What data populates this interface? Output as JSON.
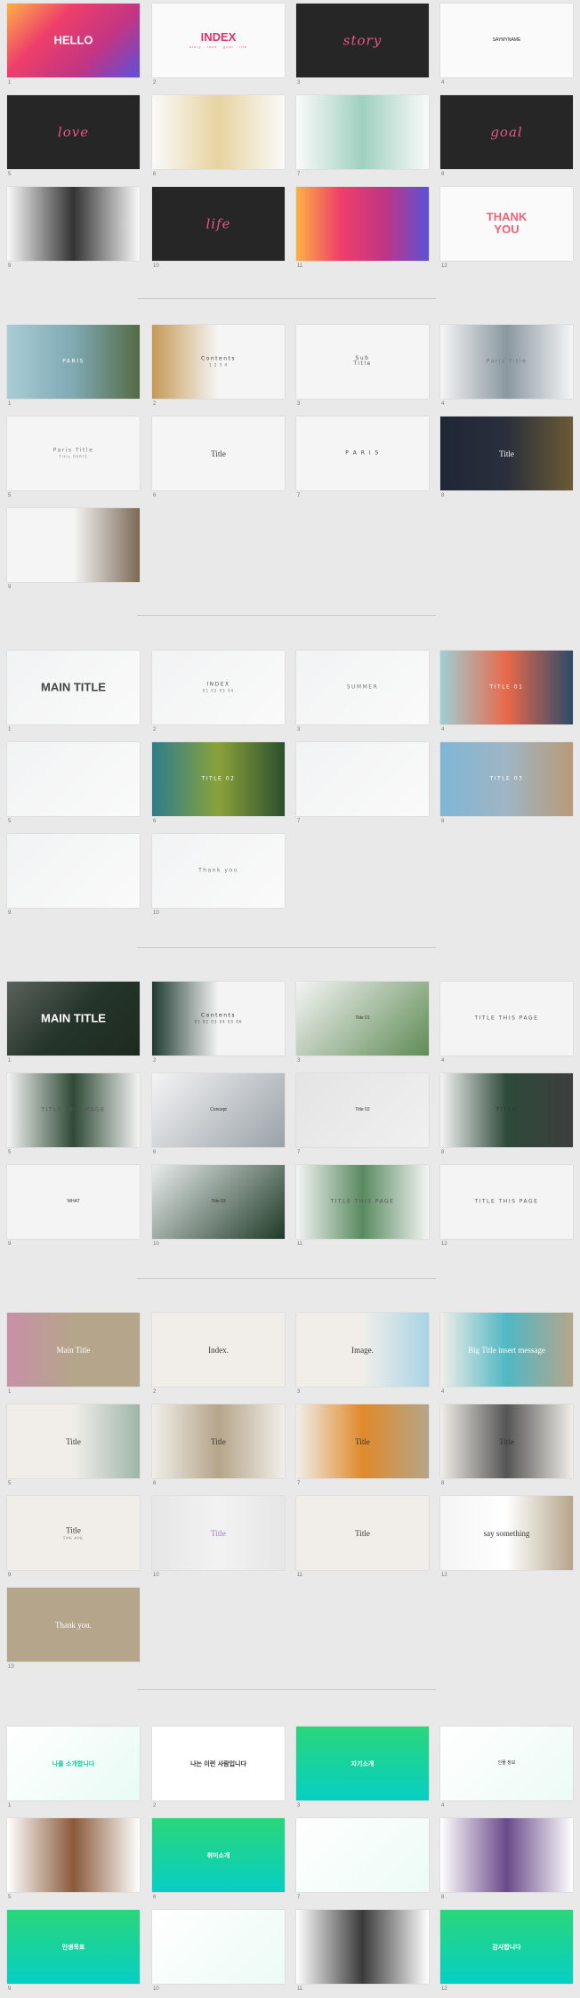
{
  "groups": [
    {
      "slides": [
        {
          "n": "1",
          "text": "HELLO",
          "style": "bold",
          "color": "#ffffff",
          "bg": [
            "#fcb045",
            "#ee3f6a",
            "#c13584",
            "#5b51d8"
          ]
        },
        {
          "n": "2",
          "text": "INDEX",
          "sub": "story · love · goal · life",
          "style": "bold",
          "color": "#e1306c",
          "bg": [
            "#fafafa",
            "#fafafa"
          ]
        },
        {
          "n": "3",
          "text": "story",
          "style": "script",
          "color": "#e8568a",
          "bg": [
            "#262626",
            "#262626"
          ]
        },
        {
          "n": "4",
          "text": "SAYMYNAME",
          "style": "small",
          "color": "#222222",
          "bg": [
            "#fafafa",
            "#fafafa"
          ]
        },
        {
          "n": "5",
          "text": "love",
          "style": "script",
          "color": "#e8568a",
          "bg": [
            "#262626",
            "#262626"
          ]
        },
        {
          "n": "6",
          "text": "",
          "style": "small",
          "color": "#222222",
          "bg": [
            "#fafafa",
            "#e7d3a0",
            "#fafafa"
          ]
        },
        {
          "n": "7",
          "text": "",
          "style": "small",
          "color": "#222222",
          "bg": [
            "#fafafa",
            "#9fd0c0",
            "#fafafa"
          ]
        },
        {
          "n": "8",
          "text": "goal",
          "style": "script",
          "color": "#e8568a",
          "bg": [
            "#262626",
            "#262626"
          ]
        },
        {
          "n": "9",
          "text": "",
          "style": "small",
          "color": "#222222",
          "bg": [
            "#fafafa",
            "#333333",
            "#fafafa"
          ]
        },
        {
          "n": "10",
          "text": "life",
          "style": "script",
          "color": "#e8568a",
          "bg": [
            "#262626",
            "#262626"
          ]
        },
        {
          "n": "11",
          "text": "",
          "style": "small",
          "color": "#ffffff",
          "bg": [
            "#fcb045",
            "#ee3f6a",
            "#c13584",
            "#5b51d8"
          ]
        },
        {
          "n": "12",
          "text": "THANK\nYOU",
          "style": "bold",
          "color": "#f0627a",
          "bg": [
            "#fafafa",
            "#fafafa"
          ]
        }
      ]
    },
    {
      "slides": [
        {
          "n": "1",
          "text": "PARIS",
          "style": "thin",
          "color": "#ffffff",
          "bg": [
            "#a9cdd6",
            "#7fa9b3",
            "#556b45"
          ]
        },
        {
          "n": "2",
          "text": "Contents",
          "sub": "1   2   3   4",
          "style": "thin",
          "color": "#444444",
          "bg": [
            "#c59a55",
            "#f5f5f5",
            "#f5f5f5"
          ]
        },
        {
          "n": "3",
          "text": "Sub\nTitle",
          "style": "thin",
          "color": "#555555",
          "bg": [
            "#f5f5f5",
            "#f5f5f5"
          ]
        },
        {
          "n": "4",
          "text": "Paris Title",
          "style": "thin",
          "color": "#777777",
          "bg": [
            "#f5f5f5",
            "#8a97a0",
            "#f5f5f5"
          ]
        },
        {
          "n": "5",
          "text": "Paris Title",
          "sub": "Title   PARIS",
          "style": "thin",
          "color": "#777777",
          "bg": [
            "#f5f5f5",
            "#f5f5f5"
          ]
        },
        {
          "n": "6",
          "text": "Title",
          "style": "serif",
          "color": "#333333",
          "bg": [
            "#f5f5f5",
            "#f5f5f5"
          ]
        },
        {
          "n": "7",
          "text": "P  A  R  I  S",
          "style": "thin",
          "color": "#444444",
          "bg": [
            "#f5f5f5",
            "#f5f5f5"
          ]
        },
        {
          "n": "8",
          "text": "Title",
          "style": "serif",
          "color": "#ffffff",
          "bg": [
            "#1f2636",
            "#2a2f3c",
            "#6b5a36"
          ]
        },
        {
          "n": "9",
          "text": "",
          "style": "thin",
          "color": "#555555",
          "bg": [
            "#f5f5f5",
            "#f5f5f5",
            "#7b6a55"
          ]
        }
      ]
    },
    {
      "slides": [
        {
          "n": "1",
          "text": "MAIN TITLE",
          "style": "bold",
          "color": "#444444",
          "bg": [
            "#f2f3f4",
            "#fafafa"
          ]
        },
        {
          "n": "2",
          "text": "INDEX",
          "sub": "01  02  03  04",
          "style": "thin",
          "color": "#555555",
          "bg": [
            "#f2f3f4",
            "#fafafa"
          ]
        },
        {
          "n": "3",
          "text": "SUMMER",
          "style": "thin",
          "color": "#777777",
          "bg": [
            "#f2f3f4",
            "#fafafa"
          ]
        },
        {
          "n": "4",
          "text": "TITLE 01",
          "style": "thin",
          "color": "#ffffff",
          "bg": [
            "#9fcfd3",
            "#e9694a",
            "#2c4a6a"
          ]
        },
        {
          "n": "5",
          "text": "",
          "style": "thin",
          "color": "#555555",
          "bg": [
            "#f2f3f4",
            "#fafafa"
          ]
        },
        {
          "n": "6",
          "text": "TITLE 02",
          "style": "thin",
          "color": "#ffffff",
          "bg": [
            "#2d7d8c",
            "#8aa23a",
            "#2b4f2e"
          ]
        },
        {
          "n": "7",
          "text": "",
          "style": "thin",
          "color": "#555555",
          "bg": [
            "#f2f3f4",
            "#fafafa"
          ]
        },
        {
          "n": "8",
          "text": "TITLE 03",
          "style": "thin",
          "color": "#ffffff",
          "bg": [
            "#7fb6d6",
            "#9fb5c4",
            "#b89a78"
          ]
        },
        {
          "n": "9",
          "text": "",
          "style": "thin",
          "color": "#555555",
          "bg": [
            "#f2f3f4",
            "#fafafa"
          ]
        },
        {
          "n": "10",
          "text": "Thank you",
          "style": "thin",
          "color": "#777777",
          "bg": [
            "#f2f3f4",
            "#fafafa"
          ]
        }
      ]
    },
    {
      "slides": [
        {
          "n": "1",
          "text": "MAIN TITLE",
          "style": "bold",
          "color": "#ffffff",
          "bg": [
            "#5b625d",
            "#25352a",
            "#1d2a20"
          ]
        },
        {
          "n": "2",
          "text": "Contents",
          "sub": "01 02 03 04 05 06",
          "style": "thin",
          "color": "#333333",
          "bg": [
            "#1e3a31",
            "#f4f4f4",
            "#f4f4f4"
          ]
        },
        {
          "n": "3",
          "text": "Title 01",
          "style": "small",
          "color": "#333333",
          "bg": [
            "#f4f4f4",
            "#5f8c55"
          ]
        },
        {
          "n": "4",
          "text": "TITLE THIS PAGE",
          "style": "thin",
          "color": "#555555",
          "bg": [
            "#f4f4f4",
            "#f4f4f4"
          ]
        },
        {
          "n": "5",
          "text": "TITLE THIS PAGE",
          "style": "thin",
          "color": "#555555",
          "bg": [
            "#f4f4f4",
            "#2f4a36",
            "#f4f4f4"
          ]
        },
        {
          "n": "6",
          "text": "Concept",
          "style": "small",
          "color": "#333333",
          "bg": [
            "#f4f4f4",
            "#9aa2a8"
          ]
        },
        {
          "n": "7",
          "text": "Title 02",
          "style": "small",
          "color": "#333333",
          "bg": [
            "#e4e4e4",
            "#f0f0f0"
          ]
        },
        {
          "n": "8",
          "text": "TITLE",
          "style": "thin",
          "color": "#333333",
          "bg": [
            "#f4f4f4",
            "#2e4a3a",
            "#3e3e3e"
          ]
        },
        {
          "n": "9",
          "text": "WHAT",
          "style": "small",
          "color": "#333333",
          "bg": [
            "#f4f4f4",
            "#f4f4f4"
          ]
        },
        {
          "n": "10",
          "text": "Title 03",
          "style": "small",
          "color": "#333333",
          "bg": [
            "#e8ecec",
            "#1f3a28"
          ]
        },
        {
          "n": "11",
          "text": "TITLE THIS PAGE",
          "style": "thin",
          "color": "#555555",
          "bg": [
            "#f4f4f4",
            "#5a8a60",
            "#f4f4f4"
          ]
        },
        {
          "n": "12",
          "text": "TITLE THIS PAGE",
          "style": "thin",
          "color": "#555555",
          "bg": [
            "#f4f4f4",
            "#f4f4f4"
          ]
        }
      ]
    },
    {
      "slides": [
        {
          "n": "1",
          "text": "Main Title",
          "style": "serif",
          "color": "#ffffff",
          "bg": [
            "#c890a8",
            "#b5a58a",
            "#b5a58a"
          ]
        },
        {
          "n": "2",
          "text": "Index.",
          "style": "serif",
          "color": "#333333",
          "bg": [
            "#f1eee9",
            "#f1eee9"
          ]
        },
        {
          "n": "3",
          "text": "Image.",
          "style": "serif",
          "color": "#333333",
          "bg": [
            "#f1eee9",
            "#f1eee9",
            "#a8d4e6"
          ]
        },
        {
          "n": "4",
          "text": "Big Title   insert message",
          "style": "serif",
          "color": "#ffffff",
          "bg": [
            "#f1eee9",
            "#4fb8c4",
            "#b5a58a"
          ]
        },
        {
          "n": "5",
          "text": "Title",
          "style": "serif",
          "color": "#333333",
          "bg": [
            "#f1eee9",
            "#f1eee9",
            "#9fb5aa"
          ]
        },
        {
          "n": "6",
          "text": "Title",
          "style": "serif",
          "color": "#333333",
          "bg": [
            "#f1eee9",
            "#b5a58a",
            "#f1eee9"
          ]
        },
        {
          "n": "7",
          "text": "Title",
          "style": "serif",
          "color": "#333333",
          "bg": [
            "#f1eee9",
            "#e08a2a",
            "#b5a58a"
          ]
        },
        {
          "n": "8",
          "text": "Title",
          "style": "serif",
          "color": "#333333",
          "bg": [
            "#f1eee9",
            "#555555",
            "#f1eee9"
          ]
        },
        {
          "n": "9",
          "text": "Title",
          "sub": "54%  46%",
          "style": "serif",
          "color": "#333333",
          "bg": [
            "#f1eee9",
            "#f1eee9"
          ]
        },
        {
          "n": "10",
          "text": "Title",
          "style": "serif",
          "color": "#9a7ab8",
          "bg": [
            "#e6e6e6",
            "#f2f2f2",
            "#e6e6e6"
          ]
        },
        {
          "n": "11",
          "text": "Title",
          "style": "serif",
          "color": "#333333",
          "bg": [
            "#f1eee9",
            "#f1eee9"
          ]
        },
        {
          "n": "12",
          "text": "say something",
          "style": "serif",
          "color": "#333333",
          "bg": [
            "#f4f4f4",
            "#ffffff",
            "#b5a58a"
          ]
        },
        {
          "n": "13",
          "text": "Thank you.",
          "style": "serif",
          "color": "#ffffff",
          "bg": [
            "#b5a58a",
            "#b5a58a"
          ]
        }
      ]
    },
    {
      "slides": [
        {
          "n": "1",
          "text": "나를 소개합니다",
          "style": "kr",
          "color": "#14c9a0",
          "bg": [
            "#ffffff",
            "#e8fbf5"
          ]
        },
        {
          "n": "2",
          "text": "나는 이런 사람입니다",
          "style": "kr",
          "color": "#333333",
          "bg": [
            "#ffffff",
            "#ffffff"
          ]
        },
        {
          "n": "3",
          "text": "자기소개",
          "style": "kr",
          "color": "#ffffff",
          "bg": [
            "#2ad67a",
            "#06cfc4"
          ],
          "vertical": true
        },
        {
          "n": "4",
          "text": "인물 정보",
          "style": "small",
          "color": "#333333",
          "bg": [
            "#ffffff",
            "#ecfbf6"
          ]
        },
        {
          "n": "5",
          "text": "",
          "style": "small",
          "color": "#333333",
          "bg": [
            "#ffffff",
            "#8a5a3a",
            "#ffffff"
          ]
        },
        {
          "n": "6",
          "text": "취미소개",
          "style": "kr",
          "color": "#ffffff",
          "bg": [
            "#2ad67a",
            "#06cfc4"
          ],
          "vertical": true
        },
        {
          "n": "7",
          "text": "",
          "style": "small",
          "color": "#333333",
          "bg": [
            "#ffffff",
            "#ecfbf6"
          ]
        },
        {
          "n": "8",
          "text": "",
          "style": "small",
          "color": "#333333",
          "bg": [
            "#ffffff",
            "#6a4a8a",
            "#ffffff"
          ]
        },
        {
          "n": "9",
          "text": "인생목표",
          "style": "kr",
          "color": "#ffffff",
          "bg": [
            "#2ad67a",
            "#06cfc4"
          ],
          "vertical": true
        },
        {
          "n": "10",
          "text": "",
          "style": "small",
          "color": "#333333",
          "bg": [
            "#ffffff",
            "#ecfbf6"
          ]
        },
        {
          "n": "11",
          "text": "",
          "style": "small",
          "color": "#333333",
          "bg": [
            "#ffffff",
            "#3a3a3a",
            "#ffffff"
          ]
        },
        {
          "n": "12",
          "text": "감사합니다",
          "style": "kr",
          "color": "#ffffff",
          "bg": [
            "#2ad67a",
            "#06cfc4"
          ],
          "vertical": true
        }
      ]
    }
  ]
}
